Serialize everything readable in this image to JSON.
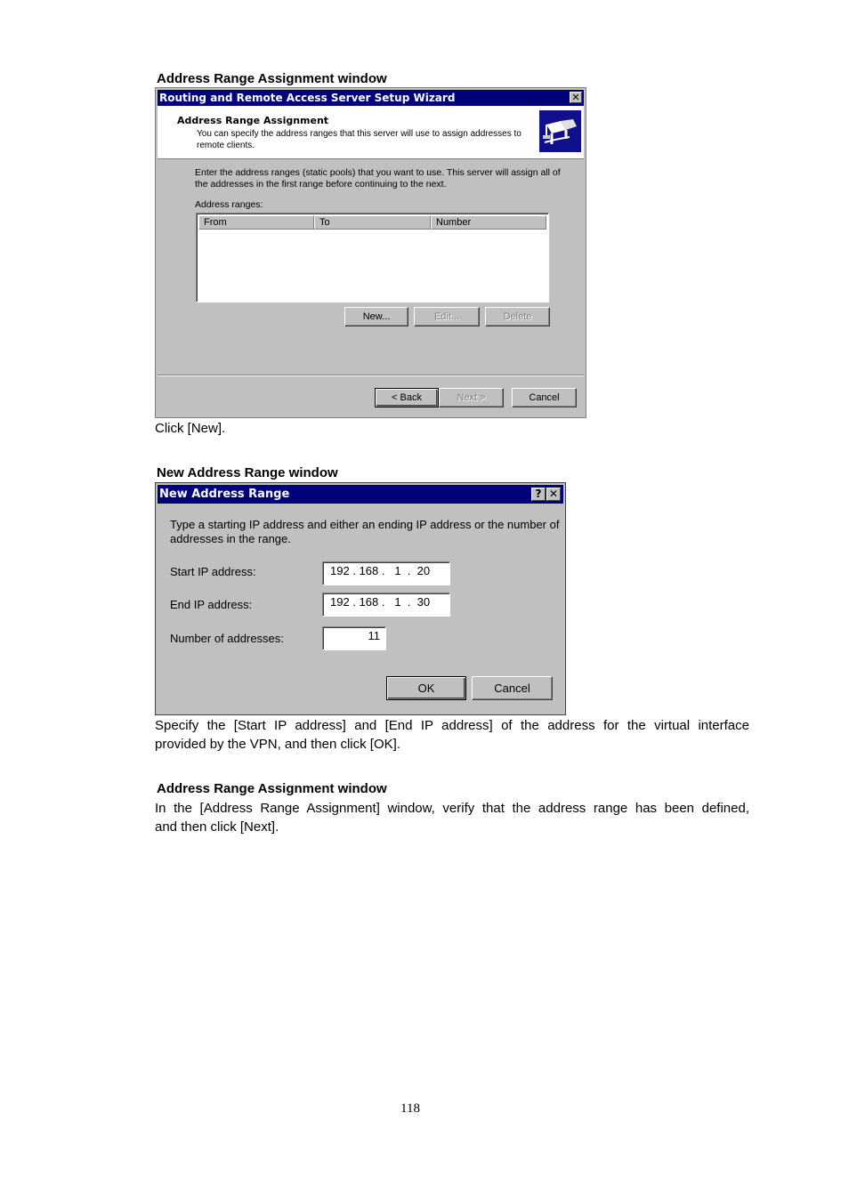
{
  "section1": {
    "heading": "Address Range Assignment window",
    "window": {
      "title": "Routing and Remote Access Server Setup Wizard",
      "header_title": "Address Range Assignment",
      "header_desc_line1": "You can specify the address ranges that this server will use to assign addresses to",
      "header_desc_line2": "remote clients.",
      "icon": "network-server-icon",
      "body_line1": "Enter the address ranges (static pools) that you want to use. This server will assign all of",
      "body_line2": "the addresses in the first range before continuing to the next.",
      "list_label": "Address ranges:",
      "columns": [
        "From",
        "To",
        "Number"
      ],
      "rows": [],
      "new_button": "New...",
      "edit_button": "Edit...",
      "delete_button": "Delete",
      "back_button": "< Back",
      "next_button": "Next >",
      "cancel_button": "Cancel"
    },
    "caption": "Click [New]."
  },
  "section2": {
    "heading": "New Address Range window",
    "window": {
      "title": "New Address Range",
      "help_button": "?",
      "close_button": "✕",
      "instruction_line1": "Type a starting IP address and either an ending IP address or the number of",
      "instruction_line2": "addresses in the range.",
      "start_label": "Start IP address:",
      "start_value": [
        "192",
        "168",
        "1",
        "20"
      ],
      "end_label": "End IP address:",
      "end_value": [
        "192",
        "168",
        "1",
        "30"
      ],
      "count_label": "Number of addresses:",
      "count_value": "11",
      "ok_button": "OK",
      "cancel_button": "Cancel"
    },
    "caption_line1": "Specify the [Start IP address] and [End IP address] of the address for the virtual interface",
    "caption_line2": "provided by the VPN, and then click [OK]."
  },
  "section3": {
    "heading": "Address Range Assignment window",
    "text_line1": "In the [Address Range Assignment] window, verify that the address range has been defined,",
    "text_line2": "and then click [Next]."
  },
  "page_number": "118"
}
